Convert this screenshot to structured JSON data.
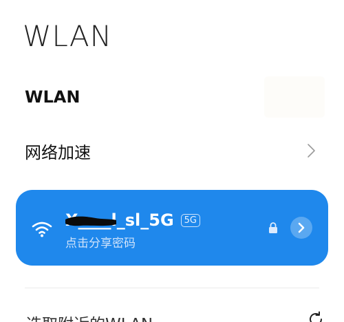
{
  "header": {
    "title": "WLAN"
  },
  "wlan_toggle": {
    "label": "WLAN"
  },
  "acceleration": {
    "label": "网络加速",
    "icon": "chevron-right-icon"
  },
  "connected_network": {
    "name": "X____l_sl_5G",
    "band": "5G",
    "subtitle": "点击分享密码",
    "secured": true,
    "card_color": "#1f88ec"
  },
  "nearby": {
    "title": "选取附近的WLAN",
    "icon": "refresh-icon"
  }
}
